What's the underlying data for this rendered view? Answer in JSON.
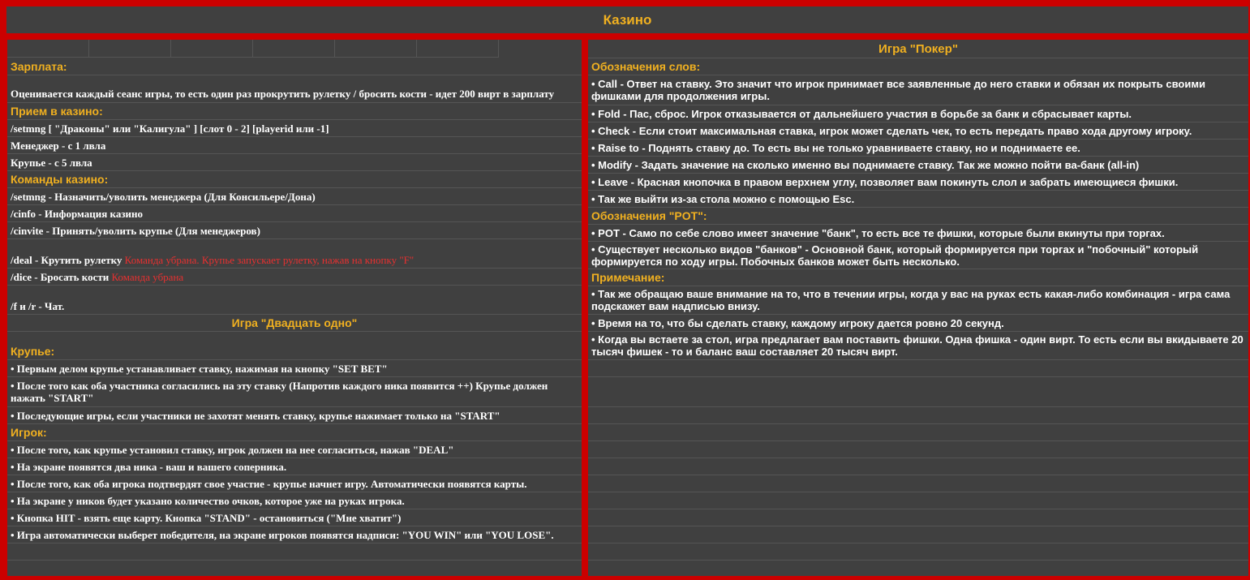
{
  "page_title": "Казино",
  "left": {
    "salary_heading": "Зарплата:",
    "salary_text": "Оценивается каждый сеанс игры, то есть один раз прокрутить рулетку / бросить кости - идет 200 вирт в зарплату",
    "hiring_heading": "Прием в казино:",
    "setmng_cmd": "/setmng [ \"Драконы\" или \"Калигула\" ] [слот 0 - 2] [playerid или -1]",
    "manager_level": "Менеджер - с 1 лвла",
    "croupier_level": "Крупье - с 5 лвла",
    "commands_heading": "Команды казино:",
    "cmd_setmng": "/setmng - Назначить/уволить менеджера (Для Консильере/Дона)",
    "cmd_cinfo": "/cinfo - Информация казино",
    "cmd_cinvite": "/cinvite - Принять/уволить крупье (Для менеджеров)",
    "cmd_deal": "/deal - Крутить рулетку",
    "cmd_deal_note": "Команда убрана. Крупье запускает рулетку, нажав на кнопку \"F\"",
    "cmd_dice": "/dice - Бросать кости",
    "cmd_dice_note": "Команда убрана",
    "cmd_chat": "/f и /r - Чат.",
    "bj_title": "Игра \"Двадцать одно\"",
    "croupier_heading": "Крупье:",
    "croupier_rules": [
      "• Первым делом крупье устанавливает ставку, нажимая на кнопку \"SET BET\"",
      "• После того как оба участника согласились на эту ставку (Напротив каждого ника появится ++) Крупье должен нажать \"START\"",
      "• Последующие игры, если участники не захотят менять ставку, крупье нажимает только на \"START\""
    ],
    "player_heading": "Игрок:",
    "player_rules": [
      "• После того, как крупье установил ставку, игрок должен на нее согласиться, нажав \"DEAL\"",
      "• На экране появятся два ника - ваш и вашего соперника.",
      "• После того, как оба игрока подтвердят свое участие - крупье начнет игру. Автоматически появятся карты.",
      "• На экране у ников будет указано количество очков, которое уже на руках игрока.",
      "• Кнопка HIT - взять еще карту. Кнопка \"STAND\" - остановиться (\"Мне хватит\")",
      "• Игра автоматически выберет победителя, на экране игроков появятся надписи: \"YOU WIN\" или \"YOU LOSE\"."
    ]
  },
  "right": {
    "poker_title": "Игра \"Покер\"",
    "words_heading": "Обозначения слов:",
    "words": [
      "• Call - Ответ на ставку. Это значит что игрок принимает все заявленные до него ставки и обязан их покрыть своими фишками для продолжения игры.",
      "• Fold - Пас, сброс. Игрок отказывается от дальнейшего участия в борьбе за банк и сбрасывает карты.",
      "• Check - Если стоит максимальная ставка, игрок может сделать чек, то есть передать право хода другому игроку.",
      "• Raise to - Поднять ставку до. То есть вы не только уравниваете ставку, но и поднимаете ее.",
      "• Modify - Задать значение на сколько именно вы поднимаете ставку. Так же можно пойти ва-банк (all-in)",
      "• Leave - Красная кнопочка в правом верхнем углу, позволяет вам покинуть слол и забрать имеющиеся фишки.",
      "• Так же выйти из-за стола можно с помощью Esc."
    ],
    "pot_heading": "Обозначения \"POT\":",
    "pot": [
      "• POT - Само по себе слово имеет значение \"банк\", то есть все те фишки, которые были вкинуты при торгах.",
      "• Существует несколько видов \"банков\" - Основной банк, который формируется при торгах и \"побочный\" который формируется по ходу игры. Побочных банков может быть несколько."
    ],
    "notes_heading": "Примечание:",
    "notes": [
      "• Так же обращаю ваше внимание на то, что в течении игры, когда у вас на руках есть какая-либо комбинация - игра сама подскажет вам надписью внизу.",
      "• Время на то, что бы сделать ставку, каждому игроку дается ровно 20 секунд.",
      "• Когда вы встаете за стол, игра предлагает вам поставить фишки. Одна фишка - один вирт. То есть если вы вкидываете 20 тысяч фишек - то и баланс ваш составляет 20 тысяч вирт."
    ]
  }
}
